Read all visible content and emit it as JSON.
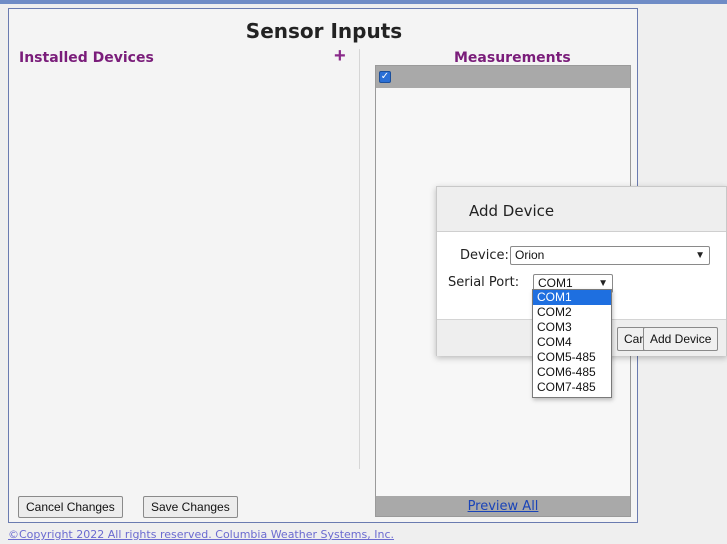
{
  "page": {
    "title": "Sensor Inputs",
    "installed_devices_title": "Installed Devices",
    "add_icon": "+",
    "measurements_title": "Measurements",
    "preview_all": "Preview All",
    "cancel_changes": "Cancel Changes",
    "save_changes": "Save Changes",
    "copyright": "©Copyright 2022 All rights reserved. Columbia Weather Systems, Inc."
  },
  "dialog": {
    "title": "Add Device",
    "device_label": "Device:",
    "device_value": "Orion",
    "serial_label": "Serial Port:",
    "serial_value": "COM1",
    "cancel_label": "Cancel",
    "add_label": "Add Device"
  },
  "serial_options": [
    "COM1",
    "COM2",
    "COM3",
    "COM4",
    "COM5-485",
    "COM6-485",
    "COM7-485"
  ],
  "colors": {
    "section_title": "#7a1d7a",
    "link": "#1a44b8",
    "selected_option": "#1e6fe0"
  },
  "icons": {
    "add": "plus-icon",
    "checkbox": "checkbox-checked-icon",
    "chevron": "chevron-down-icon"
  }
}
